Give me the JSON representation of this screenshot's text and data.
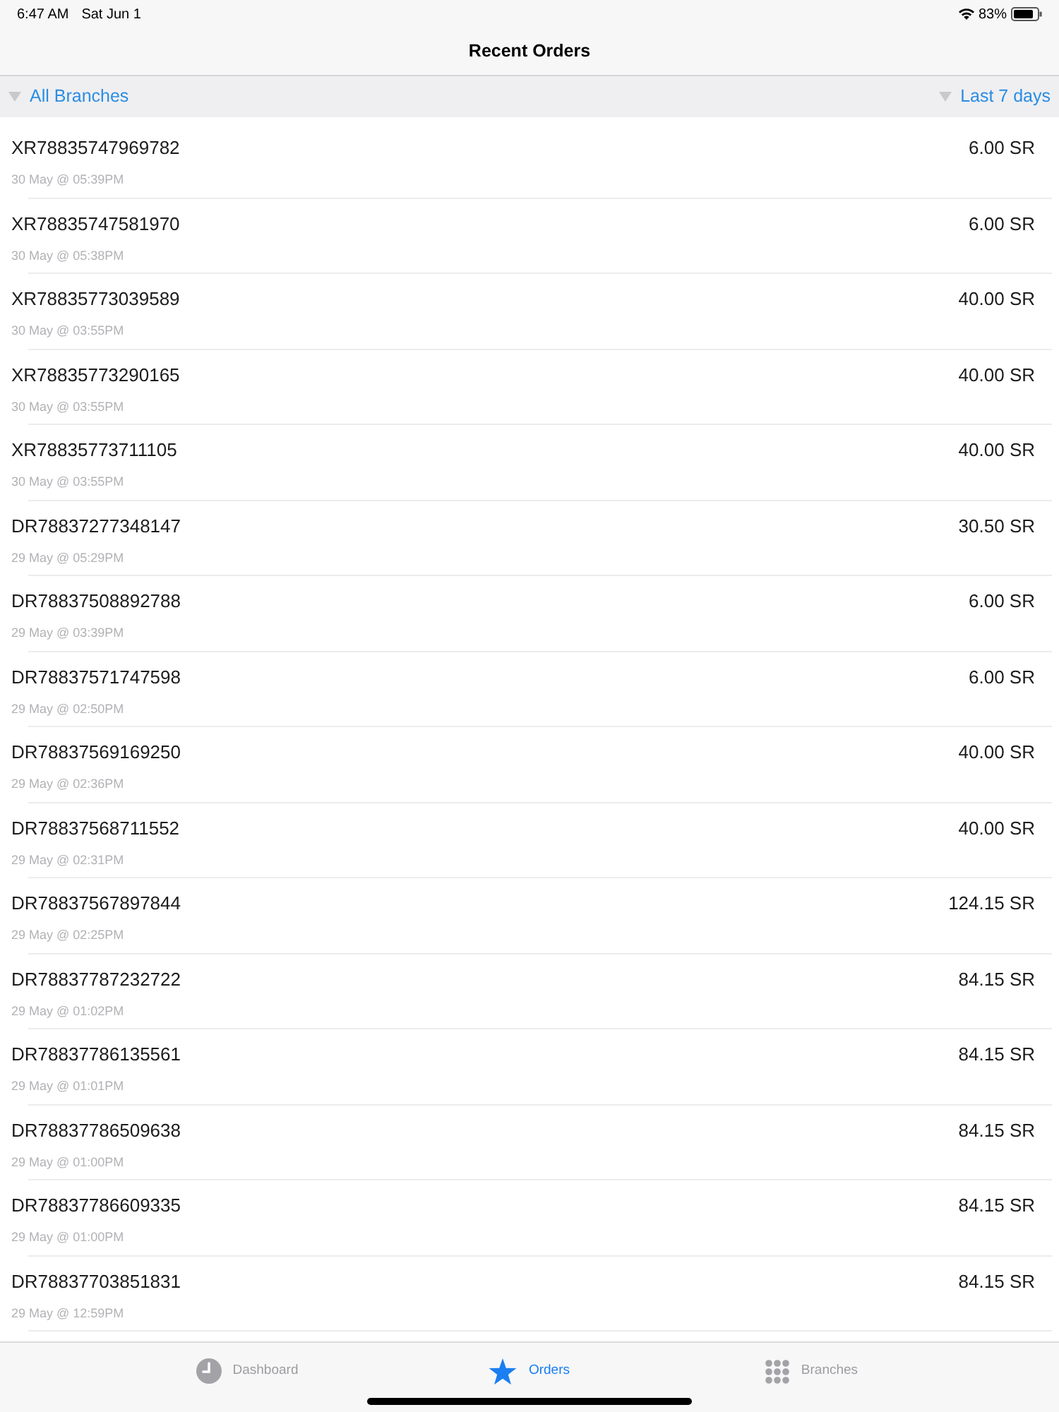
{
  "status_bar": {
    "time": "6:47 AM",
    "date": "Sat Jun 1",
    "battery": "83%"
  },
  "nav_bar": {
    "title": "Recent Orders"
  },
  "filters": [
    {
      "label": "All Branches"
    },
    {
      "label": "Last 7 days"
    }
  ],
  "orders": [
    {
      "id": "XR78835747969782",
      "date": "30 May @ 05:39PM",
      "amount": "6.00 SR"
    },
    {
      "id": "XR78835747581970",
      "date": "30 May @ 05:38PM",
      "amount": "6.00 SR"
    },
    {
      "id": "XR78835773039589",
      "date": "30 May @ 03:55PM",
      "amount": "40.00 SR"
    },
    {
      "id": "XR78835773290165",
      "date": "30 May @ 03:55PM",
      "amount": "40.00 SR"
    },
    {
      "id": "XR78835773711105",
      "date": "30 May @ 03:55PM",
      "amount": "40.00 SR"
    },
    {
      "id": "DR78837277348147",
      "date": "29 May @ 05:29PM",
      "amount": "30.50 SR"
    },
    {
      "id": "DR78837508892788",
      "date": "29 May @ 03:39PM",
      "amount": "6.00 SR"
    },
    {
      "id": "DR78837571747598",
      "date": "29 May @ 02:50PM",
      "amount": "6.00 SR"
    },
    {
      "id": "DR78837569169250",
      "date": "29 May @ 02:36PM",
      "amount": "40.00 SR"
    },
    {
      "id": "DR78837568711552",
      "date": "29 May @ 02:31PM",
      "amount": "40.00 SR"
    },
    {
      "id": "DR78837567897844",
      "date": "29 May @ 02:25PM",
      "amount": "124.15 SR"
    },
    {
      "id": "DR78837787232722",
      "date": "29 May @ 01:02PM",
      "amount": "84.15 SR"
    },
    {
      "id": "DR78837786135561",
      "date": "29 May @ 01:01PM",
      "amount": "84.15 SR"
    },
    {
      "id": "DR78837786509638",
      "date": "29 May @ 01:00PM",
      "amount": "84.15 SR"
    },
    {
      "id": "DR78837786609335",
      "date": "29 May @ 01:00PM",
      "amount": "84.15 SR"
    },
    {
      "id": "DR78837703851831",
      "date": "29 May @ 12:59PM",
      "amount": "84.15 SR"
    }
  ],
  "tab_bar": {
    "tabs": [
      {
        "label": "Dashboard",
        "selected": false
      },
      {
        "label": "Orders",
        "selected": true
      },
      {
        "label": "Branches",
        "selected": false
      }
    ]
  }
}
